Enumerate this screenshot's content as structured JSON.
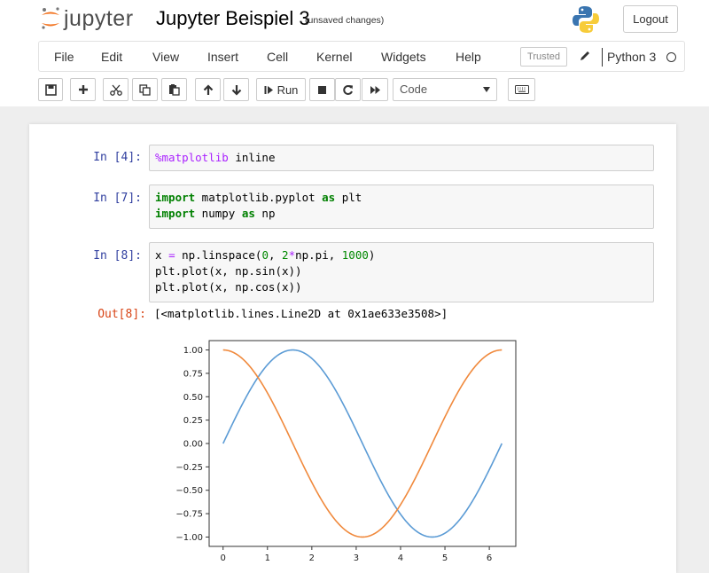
{
  "header": {
    "logo_text": "jupyter",
    "notebook_title": "Jupyter Beispiel 3",
    "save_status": "(unsaved changes)",
    "logout_label": "Logout"
  },
  "menubar": {
    "items": [
      "File",
      "Edit",
      "View",
      "Insert",
      "Cell",
      "Kernel",
      "Widgets",
      "Help"
    ],
    "trusted_label": "Trusted",
    "kernel_name": "Python 3"
  },
  "toolbar": {
    "run_label": "Run",
    "cell_type": "Code",
    "icons": [
      "save-icon",
      "plus-icon",
      "scissors-icon",
      "copy-icon",
      "paste-icon",
      "arrow-up-icon",
      "arrow-down-icon",
      "run-icon",
      "stop-icon",
      "restart-icon",
      "fast-forward-icon",
      "keyboard-icon"
    ]
  },
  "cells": [
    {
      "prompt": "In [4]:",
      "lines": [
        [
          {
            "t": "%matplotlib",
            "c": "magic"
          },
          {
            "t": " inline",
            "c": ""
          }
        ]
      ]
    },
    {
      "prompt": "In [7]:",
      "lines": [
        [
          {
            "t": "import",
            "c": "kw"
          },
          {
            "t": " matplotlib.pyplot ",
            "c": ""
          },
          {
            "t": "as",
            "c": "kw"
          },
          {
            "t": " plt",
            "c": ""
          }
        ],
        [
          {
            "t": "import",
            "c": "kw"
          },
          {
            "t": " numpy ",
            "c": ""
          },
          {
            "t": "as",
            "c": "kw"
          },
          {
            "t": " np",
            "c": ""
          }
        ]
      ]
    },
    {
      "prompt": "In [8]:",
      "lines": [
        [
          {
            "t": "x ",
            "c": ""
          },
          {
            "t": "=",
            "c": "op"
          },
          {
            "t": " np.linspace(",
            "c": ""
          },
          {
            "t": "0",
            "c": "num"
          },
          {
            "t": ", ",
            "c": ""
          },
          {
            "t": "2",
            "c": "num"
          },
          {
            "t": "*",
            "c": "op"
          },
          {
            "t": "np.pi, ",
            "c": ""
          },
          {
            "t": "1000",
            "c": "num"
          },
          {
            "t": ")",
            "c": ""
          }
        ],
        [
          {
            "t": "plt.plot(x, np.sin(x))",
            "c": ""
          }
        ],
        [
          {
            "t": "plt.plot(x, np.cos(x))",
            "c": ""
          }
        ]
      ]
    }
  ],
  "output": {
    "prompt": "Out[8]:",
    "text": "[<matplotlib.lines.Line2D at 0x1ae633e3508>]"
  },
  "chart_data": {
    "type": "line",
    "x_range": [
      0,
      6.283
    ],
    "xlim": [
      -0.314,
      6.597
    ],
    "ylim": [
      -1.1,
      1.1
    ],
    "xticks": [
      0,
      1,
      2,
      3,
      4,
      5,
      6
    ],
    "yticks": [
      1.0,
      0.75,
      0.5,
      0.25,
      0.0,
      -0.25,
      -0.5,
      -0.75,
      -1.0
    ],
    "ytick_labels": [
      "1.00",
      "0.75",
      "0.50",
      "0.25",
      "0.00",
      "−0.25",
      "−0.50",
      "−0.75",
      "−1.00"
    ],
    "grid": false,
    "series": [
      {
        "function": "sin",
        "color": "#5b9bd5"
      },
      {
        "function": "cos",
        "color": "#f0893c"
      }
    ]
  }
}
